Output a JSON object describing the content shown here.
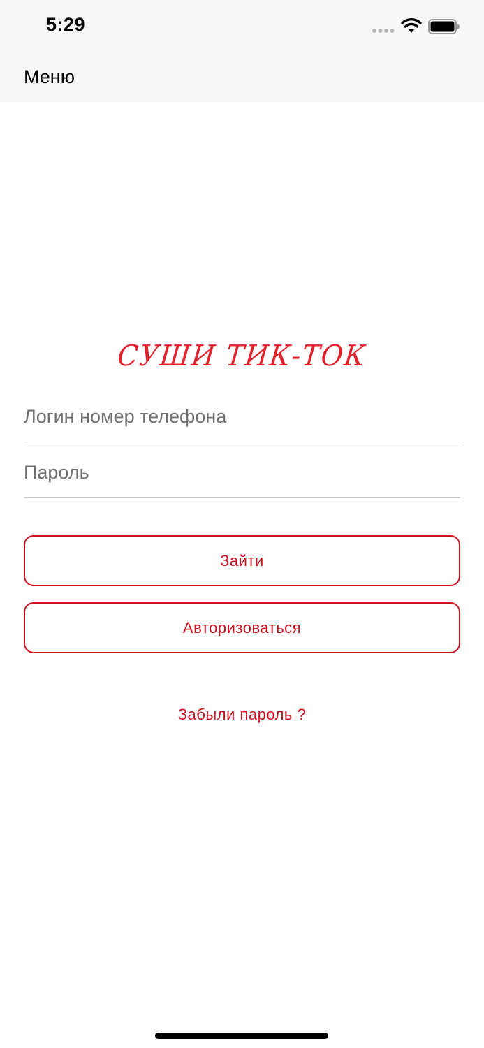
{
  "status_bar": {
    "time": "5:29"
  },
  "nav": {
    "menu_label": "Меню"
  },
  "logo": {
    "text": "СУШИ ТИК-ТОК"
  },
  "form": {
    "login_placeholder": "Логин номер телефона",
    "login_value": "",
    "password_placeholder": "Пароль",
    "password_value": ""
  },
  "buttons": {
    "login_label": "Зайти",
    "authorize_label": "Авторизоваться"
  },
  "links": {
    "forgot_password": "Забыли пароль ?"
  },
  "colors": {
    "accent": "#cc1020",
    "logo": "#e3212d",
    "bar_background": "#f7f7f7",
    "divider": "#c8c8cc",
    "placeholder": "#707070"
  },
  "icons": {
    "signal": "cellular-signal-icon",
    "wifi": "wifi-icon",
    "battery": "battery-icon"
  }
}
